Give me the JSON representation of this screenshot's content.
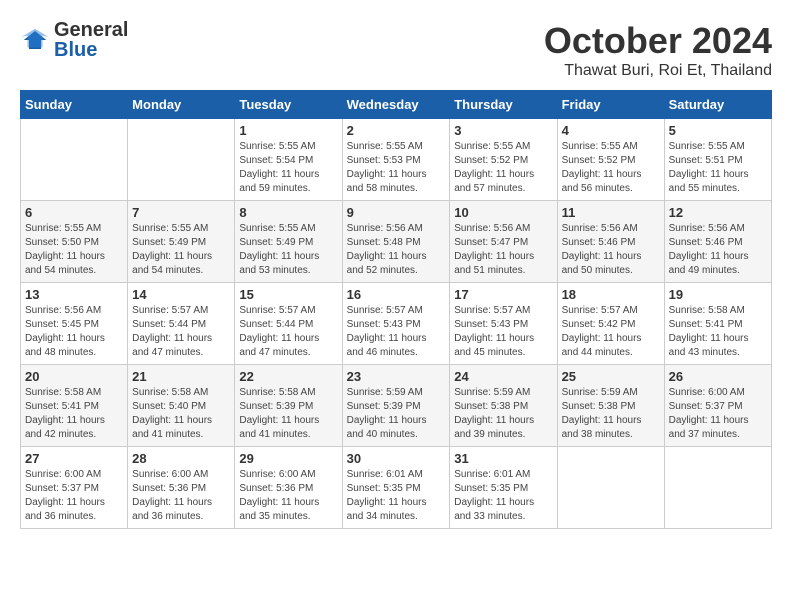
{
  "header": {
    "logo": {
      "line1": "General",
      "line2": "Blue"
    },
    "month": "October 2024",
    "location": "Thawat Buri, Roi Et, Thailand"
  },
  "weekdays": [
    "Sunday",
    "Monday",
    "Tuesday",
    "Wednesday",
    "Thursday",
    "Friday",
    "Saturday"
  ],
  "weeks": [
    [
      {
        "day": "",
        "sunrise": "",
        "sunset": "",
        "daylight": ""
      },
      {
        "day": "",
        "sunrise": "",
        "sunset": "",
        "daylight": ""
      },
      {
        "day": "1",
        "sunrise": "Sunrise: 5:55 AM",
        "sunset": "Sunset: 5:54 PM",
        "daylight": "Daylight: 11 hours and 59 minutes."
      },
      {
        "day": "2",
        "sunrise": "Sunrise: 5:55 AM",
        "sunset": "Sunset: 5:53 PM",
        "daylight": "Daylight: 11 hours and 58 minutes."
      },
      {
        "day": "3",
        "sunrise": "Sunrise: 5:55 AM",
        "sunset": "Sunset: 5:52 PM",
        "daylight": "Daylight: 11 hours and 57 minutes."
      },
      {
        "day": "4",
        "sunrise": "Sunrise: 5:55 AM",
        "sunset": "Sunset: 5:52 PM",
        "daylight": "Daylight: 11 hours and 56 minutes."
      },
      {
        "day": "5",
        "sunrise": "Sunrise: 5:55 AM",
        "sunset": "Sunset: 5:51 PM",
        "daylight": "Daylight: 11 hours and 55 minutes."
      }
    ],
    [
      {
        "day": "6",
        "sunrise": "Sunrise: 5:55 AM",
        "sunset": "Sunset: 5:50 PM",
        "daylight": "Daylight: 11 hours and 54 minutes."
      },
      {
        "day": "7",
        "sunrise": "Sunrise: 5:55 AM",
        "sunset": "Sunset: 5:49 PM",
        "daylight": "Daylight: 11 hours and 54 minutes."
      },
      {
        "day": "8",
        "sunrise": "Sunrise: 5:55 AM",
        "sunset": "Sunset: 5:49 PM",
        "daylight": "Daylight: 11 hours and 53 minutes."
      },
      {
        "day": "9",
        "sunrise": "Sunrise: 5:56 AM",
        "sunset": "Sunset: 5:48 PM",
        "daylight": "Daylight: 11 hours and 52 minutes."
      },
      {
        "day": "10",
        "sunrise": "Sunrise: 5:56 AM",
        "sunset": "Sunset: 5:47 PM",
        "daylight": "Daylight: 11 hours and 51 minutes."
      },
      {
        "day": "11",
        "sunrise": "Sunrise: 5:56 AM",
        "sunset": "Sunset: 5:46 PM",
        "daylight": "Daylight: 11 hours and 50 minutes."
      },
      {
        "day": "12",
        "sunrise": "Sunrise: 5:56 AM",
        "sunset": "Sunset: 5:46 PM",
        "daylight": "Daylight: 11 hours and 49 minutes."
      }
    ],
    [
      {
        "day": "13",
        "sunrise": "Sunrise: 5:56 AM",
        "sunset": "Sunset: 5:45 PM",
        "daylight": "Daylight: 11 hours and 48 minutes."
      },
      {
        "day": "14",
        "sunrise": "Sunrise: 5:57 AM",
        "sunset": "Sunset: 5:44 PM",
        "daylight": "Daylight: 11 hours and 47 minutes."
      },
      {
        "day": "15",
        "sunrise": "Sunrise: 5:57 AM",
        "sunset": "Sunset: 5:44 PM",
        "daylight": "Daylight: 11 hours and 47 minutes."
      },
      {
        "day": "16",
        "sunrise": "Sunrise: 5:57 AM",
        "sunset": "Sunset: 5:43 PM",
        "daylight": "Daylight: 11 hours and 46 minutes."
      },
      {
        "day": "17",
        "sunrise": "Sunrise: 5:57 AM",
        "sunset": "Sunset: 5:43 PM",
        "daylight": "Daylight: 11 hours and 45 minutes."
      },
      {
        "day": "18",
        "sunrise": "Sunrise: 5:57 AM",
        "sunset": "Sunset: 5:42 PM",
        "daylight": "Daylight: 11 hours and 44 minutes."
      },
      {
        "day": "19",
        "sunrise": "Sunrise: 5:58 AM",
        "sunset": "Sunset: 5:41 PM",
        "daylight": "Daylight: 11 hours and 43 minutes."
      }
    ],
    [
      {
        "day": "20",
        "sunrise": "Sunrise: 5:58 AM",
        "sunset": "Sunset: 5:41 PM",
        "daylight": "Daylight: 11 hours and 42 minutes."
      },
      {
        "day": "21",
        "sunrise": "Sunrise: 5:58 AM",
        "sunset": "Sunset: 5:40 PM",
        "daylight": "Daylight: 11 hours and 41 minutes."
      },
      {
        "day": "22",
        "sunrise": "Sunrise: 5:58 AM",
        "sunset": "Sunset: 5:39 PM",
        "daylight": "Daylight: 11 hours and 41 minutes."
      },
      {
        "day": "23",
        "sunrise": "Sunrise: 5:59 AM",
        "sunset": "Sunset: 5:39 PM",
        "daylight": "Daylight: 11 hours and 40 minutes."
      },
      {
        "day": "24",
        "sunrise": "Sunrise: 5:59 AM",
        "sunset": "Sunset: 5:38 PM",
        "daylight": "Daylight: 11 hours and 39 minutes."
      },
      {
        "day": "25",
        "sunrise": "Sunrise: 5:59 AM",
        "sunset": "Sunset: 5:38 PM",
        "daylight": "Daylight: 11 hours and 38 minutes."
      },
      {
        "day": "26",
        "sunrise": "Sunrise: 6:00 AM",
        "sunset": "Sunset: 5:37 PM",
        "daylight": "Daylight: 11 hours and 37 minutes."
      }
    ],
    [
      {
        "day": "27",
        "sunrise": "Sunrise: 6:00 AM",
        "sunset": "Sunset: 5:37 PM",
        "daylight": "Daylight: 11 hours and 36 minutes."
      },
      {
        "day": "28",
        "sunrise": "Sunrise: 6:00 AM",
        "sunset": "Sunset: 5:36 PM",
        "daylight": "Daylight: 11 hours and 36 minutes."
      },
      {
        "day": "29",
        "sunrise": "Sunrise: 6:00 AM",
        "sunset": "Sunset: 5:36 PM",
        "daylight": "Daylight: 11 hours and 35 minutes."
      },
      {
        "day": "30",
        "sunrise": "Sunrise: 6:01 AM",
        "sunset": "Sunset: 5:35 PM",
        "daylight": "Daylight: 11 hours and 34 minutes."
      },
      {
        "day": "31",
        "sunrise": "Sunrise: 6:01 AM",
        "sunset": "Sunset: 5:35 PM",
        "daylight": "Daylight: 11 hours and 33 minutes."
      },
      {
        "day": "",
        "sunrise": "",
        "sunset": "",
        "daylight": ""
      },
      {
        "day": "",
        "sunrise": "",
        "sunset": "",
        "daylight": ""
      }
    ]
  ]
}
